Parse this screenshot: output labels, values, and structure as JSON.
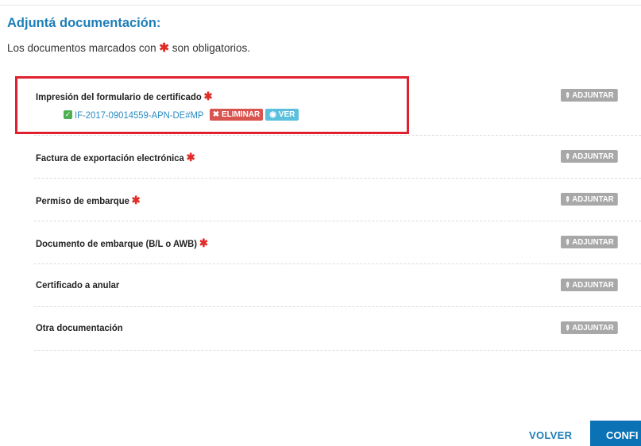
{
  "section": {
    "title": "Adjuntá documentación:",
    "subtitle_before": "Los documentos marcados con",
    "required_marker": "✱",
    "subtitle_after": "son obligatorios."
  },
  "documents": [
    {
      "label": "Impresión del formulario de certificado",
      "required": true,
      "attached_file": "IF-2017-09014559-APN-DE#MP",
      "eliminar_label": "ELIMINAR",
      "ver_label": "VER"
    },
    {
      "label": "Factura de exportación electrónica",
      "required": true
    },
    {
      "label": "Permiso de embarque",
      "required": true
    },
    {
      "label": "Documento de embarque (B/L o AWB)",
      "required": true
    },
    {
      "label": "Certificado a anular",
      "required": false
    },
    {
      "label": "Otra documentación",
      "required": false
    }
  ],
  "adjuntar_label": "ADJUNTAR",
  "footer": {
    "volver_label": "VOLVER",
    "confirmar_label": "CONFI"
  },
  "colors": {
    "heading": "#1d7eb8",
    "required": "#e02b27",
    "highlight": "#e0202e",
    "eliminar": "#d9534f",
    "ver": "#5bc0de",
    "adjuntar": "#a8a8a8",
    "primary": "#0a72b5"
  },
  "icons": {
    "adjuntar": "paperclip-icon",
    "attached": "check-square-icon",
    "eliminar": "times-icon",
    "ver": "eye-icon"
  }
}
